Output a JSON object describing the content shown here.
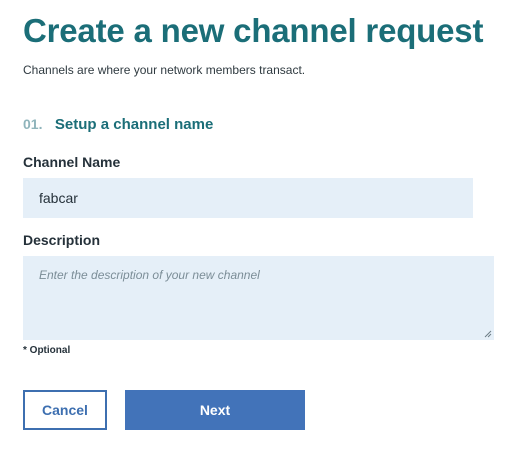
{
  "page": {
    "title": "Create a new channel request",
    "subtitle": "Channels are where your network members transact."
  },
  "step": {
    "number": "01.",
    "title": "Setup a channel name"
  },
  "form": {
    "channel_name": {
      "label": "Channel Name",
      "value": "fabcar"
    },
    "description": {
      "label": "Description",
      "value": "",
      "placeholder": "Enter the description of your new channel"
    },
    "optional_note": "* Optional"
  },
  "actions": {
    "cancel_label": "Cancel",
    "next_label": "Next"
  },
  "colors": {
    "title": "#1b6e78",
    "step_number": "#8fb4bb",
    "input_background": "#e5eff8",
    "primary_button": "#4273b9",
    "secondary_border": "#3d6fb0"
  }
}
